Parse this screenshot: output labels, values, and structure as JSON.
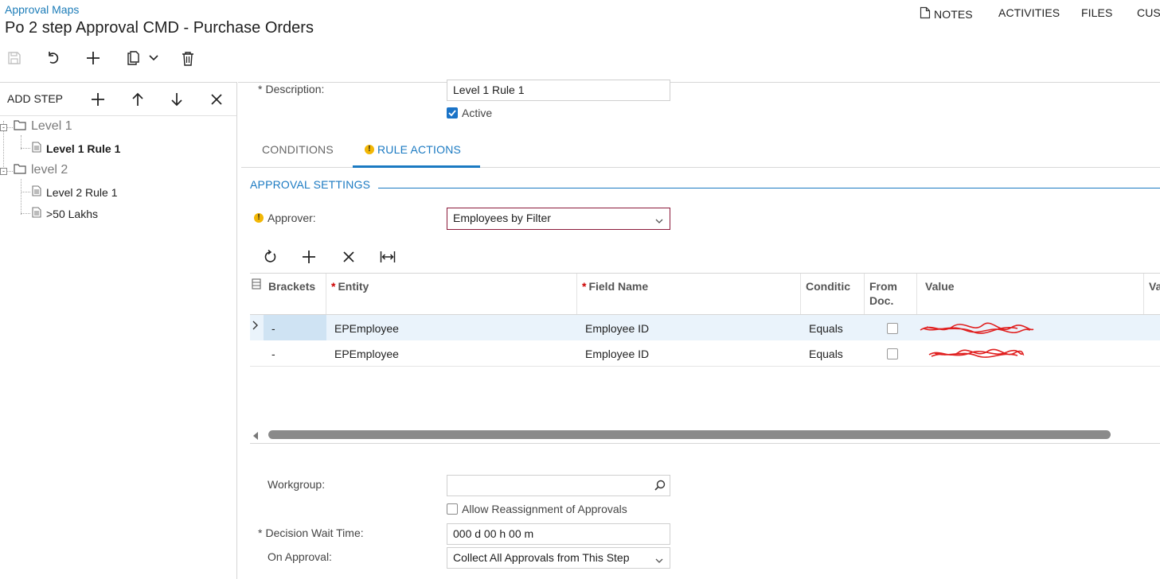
{
  "header": {
    "breadcrumb": "Approval Maps",
    "title": "Po 2 step Approval CMD - Purchase Orders",
    "links": {
      "notes": "NOTES",
      "activities": "ACTIVITIES",
      "files": "FILES",
      "customization": "CUST"
    }
  },
  "toolbar": {
    "icons": [
      "save-icon",
      "undo-icon",
      "add-icon",
      "copy-paste-icon",
      "chevron-down-icon",
      "delete-icon"
    ]
  },
  "tree_toolbar": {
    "add_step_label": "ADD STEP",
    "icons": [
      "add-icon",
      "arrow-up-icon",
      "arrow-down-icon",
      "close-icon"
    ]
  },
  "tree": {
    "levels": [
      {
        "label": "Level 1",
        "rules": [
          "Level 1 Rule 1"
        ]
      },
      {
        "label": "level 2",
        "rules": [
          "Level 2 Rule 1",
          ">50 Lakhs"
        ]
      }
    ],
    "selected_rule": "Level 1 Rule 1"
  },
  "form": {
    "description_label": "Description:",
    "description_value": "Level 1 Rule 1",
    "active_label": "Active",
    "active_checked": true
  },
  "tabs": [
    {
      "label": "CONDITIONS",
      "active": false
    },
    {
      "label": "RULE ACTIONS",
      "active": true,
      "warning": true
    }
  ],
  "approval_settings": {
    "section_title": "APPROVAL SETTINGS",
    "approver_label": "Approver:",
    "approver_value": "Employees by Filter"
  },
  "grid": {
    "toolbar_icons": [
      "refresh-icon",
      "add-icon",
      "close-icon",
      "fit-columns-icon"
    ],
    "columns": [
      {
        "label": "Brackets",
        "required": false
      },
      {
        "label": "Entity",
        "required": true
      },
      {
        "label": "Field Name",
        "required": true
      },
      {
        "label": "Conditic",
        "required": false
      },
      {
        "label": "From Doc.",
        "required": false
      },
      {
        "label": "Value",
        "required": false
      },
      {
        "label": "Va",
        "required": false
      }
    ],
    "rows": [
      {
        "brackets": "-",
        "entity": "EPEmployee",
        "field_name": "Employee ID",
        "condition": "Equals",
        "from_doc": false,
        "value_redacted": true
      },
      {
        "brackets": "-",
        "entity": "EPEmployee",
        "field_name": "Employee ID",
        "condition": "Equals",
        "from_doc": false,
        "value_redacted": true
      }
    ]
  },
  "bottom_form": {
    "workgroup_label": "Workgroup:",
    "workgroup_value": "",
    "allow_reassign_label": "Allow Reassignment of Approvals",
    "allow_reassign_checked": false,
    "decision_wait_label": "Decision Wait Time:",
    "decision_wait_value": "000 d 00 h 00 m",
    "on_approval_label": "On Approval:",
    "on_approval_value": "Collect All Approvals from This Step"
  },
  "colors": {
    "accent": "#1b7ac2",
    "warning": "#f2b705",
    "redaction": "#e02020",
    "select_border_highlight": "#8b1a3a"
  }
}
